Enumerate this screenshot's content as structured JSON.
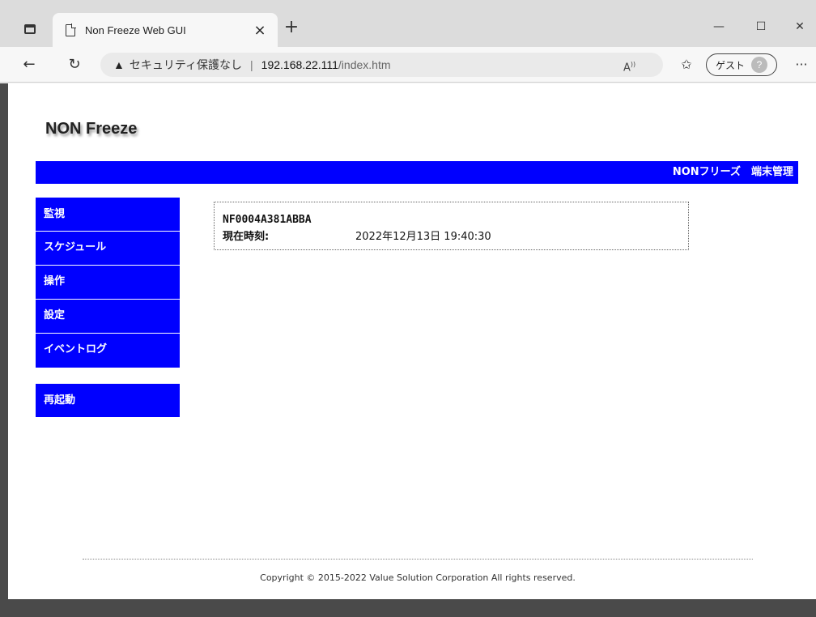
{
  "browser": {
    "tab_title": "Non Freeze Web GUI",
    "tab_close": "×",
    "new_tab": "+",
    "minimize": "—",
    "maximize": "☐",
    "close": "✕",
    "back": "←",
    "reload": "↻",
    "security_warning": "セキュリティ保護なし",
    "separator": "|",
    "url_host": "192.168.22.111",
    "url_path": "/index.htm",
    "read_aloud": "A",
    "favorites": "✩",
    "guest_label": "ゲスト",
    "more": "···"
  },
  "page": {
    "logo": "NON Freeze",
    "header_title": "NONフリーズ　端末管理",
    "menu": [
      {
        "label": "監視"
      },
      {
        "label": "スケジュール"
      },
      {
        "label": "操作"
      },
      {
        "label": "設定"
      },
      {
        "label": "イベントログ"
      }
    ],
    "restart_label": "再起動",
    "device_id": "NF0004A381ABBA",
    "current_time_label": "現在時刻:",
    "current_time_value": "2022年12月13日 19:40:30",
    "copyright": "Copyright © 2015-2022 Value Solution Corporation All rights reserved."
  },
  "colors": {
    "brand_blue": "#0000ff",
    "page_bg": "#ffffff"
  }
}
